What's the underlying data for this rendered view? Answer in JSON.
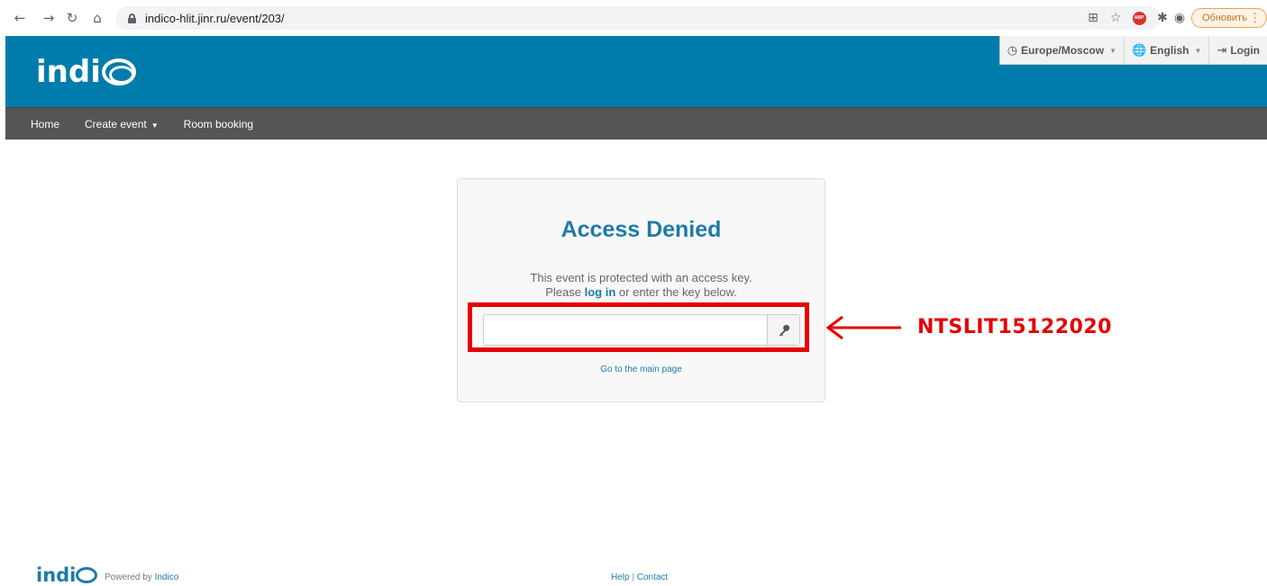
{
  "browser": {
    "url": "indico-hlit.jinr.ru/event/203/",
    "update_label": "Обновить"
  },
  "header": {
    "logo": "indico",
    "timezone": "Europe/Moscow",
    "language": "English",
    "login": "Login"
  },
  "nav": {
    "home": "Home",
    "create_event": "Create event",
    "room_booking": "Room booking"
  },
  "access": {
    "title": "Access Denied",
    "line1": "This event is protected with an access key.",
    "line2_prefix": "Please",
    "login_link": "log in",
    "line2_suffix": "or enter the key below.",
    "key_value": "",
    "main_page_link": "Go to the main page"
  },
  "annotation": {
    "key_text": "NTSLIT15122020",
    "color": "#e50000"
  },
  "footer": {
    "logo": "indico",
    "powered_prefix": "Powered by",
    "powered_link": "Indico",
    "help": "Help",
    "separator": "|",
    "contact": "Contact"
  },
  "colors": {
    "header_blue": "#007cac",
    "nav_gray": "#555555",
    "link_blue": "#1e7ba8"
  }
}
